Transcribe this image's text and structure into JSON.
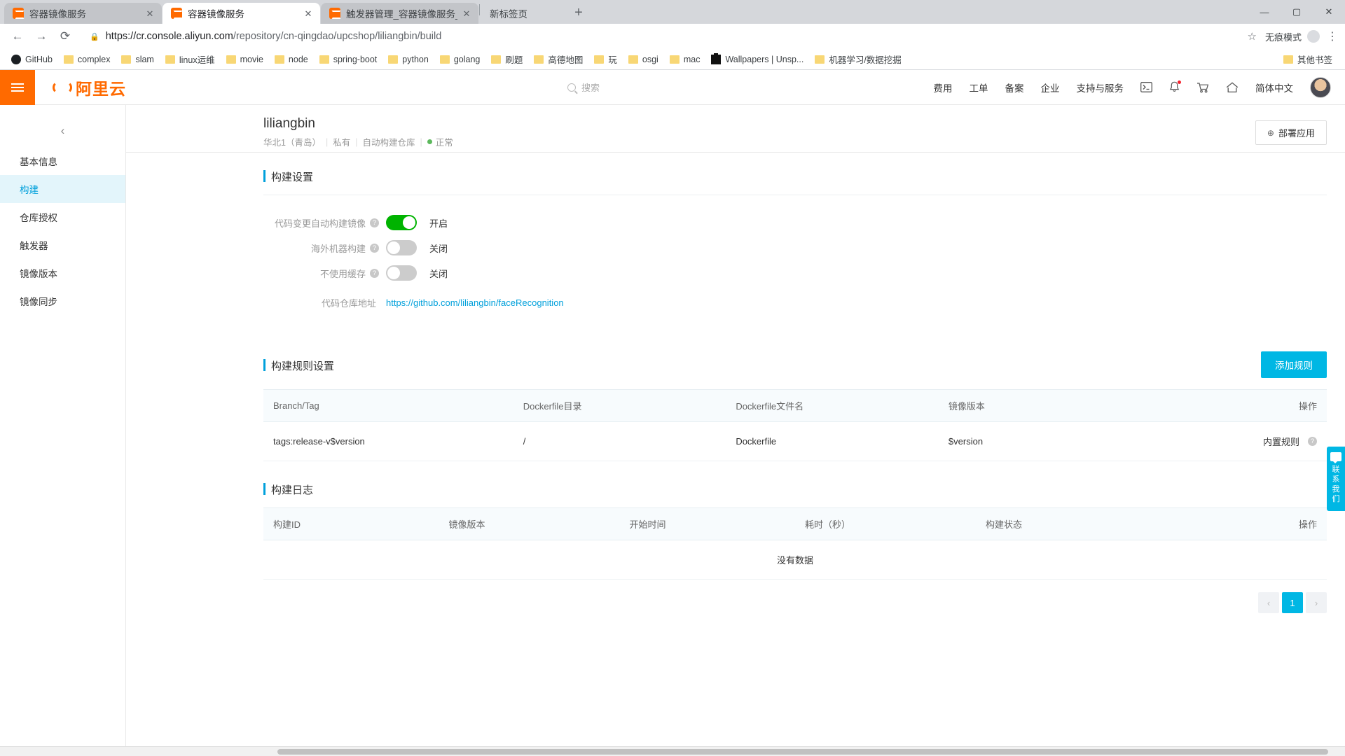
{
  "browser": {
    "tabs": [
      {
        "title": "容器镜像服务",
        "active": false,
        "close": "✕"
      },
      {
        "title": "容器镜像服务",
        "active": true,
        "close": "✕"
      },
      {
        "title": "触发器管理_容器镜像服务_用户…",
        "active": false,
        "close": "✕"
      }
    ],
    "plain_tab": "新标签页",
    "new_tab_icon": "+",
    "window_controls": {
      "minimize": "—",
      "maximize": "▢",
      "close": "✕"
    },
    "nav": {
      "back": "←",
      "forward": "→",
      "reload": "⟳"
    },
    "omnibox": {
      "lock_icon": "🔒",
      "host": "https://cr.console.aliyun.com",
      "path": "/repository/cn-qingdao/upcshop/liliangbin/build",
      "star_icon": "☆"
    },
    "incognito_label": "无痕模式",
    "menu_icon": "⋮",
    "bookmarks": [
      {
        "label": "GitHub",
        "icon": "github-icon"
      },
      {
        "label": "complex",
        "icon": "folder-icon"
      },
      {
        "label": "slam",
        "icon": "folder-icon"
      },
      {
        "label": "linux运维",
        "icon": "folder-icon"
      },
      {
        "label": "movie",
        "icon": "folder-icon"
      },
      {
        "label": "node",
        "icon": "folder-icon"
      },
      {
        "label": "spring-boot",
        "icon": "folder-icon"
      },
      {
        "label": "python",
        "icon": "folder-icon"
      },
      {
        "label": "golang",
        "icon": "folder-icon"
      },
      {
        "label": "刷题",
        "icon": "folder-icon"
      },
      {
        "label": "高德地图",
        "icon": "folder-icon"
      },
      {
        "label": "玩",
        "icon": "folder-icon"
      },
      {
        "label": "osgi",
        "icon": "folder-icon"
      },
      {
        "label": "mac",
        "icon": "folder-icon"
      },
      {
        "label": "Wallpapers | Unsp...",
        "icon": "unsplash-icon"
      },
      {
        "label": "机器学习/数据挖掘",
        "icon": "folder-icon"
      }
    ],
    "other_bookmarks": "其他书签"
  },
  "header": {
    "logo_text": "阿里云",
    "search_placeholder": "搜索",
    "nav_items": [
      "费用",
      "工单",
      "备案",
      "企业",
      "支持与服务"
    ],
    "icons": [
      {
        "name": "terminal-icon",
        "glyph": "▣"
      },
      {
        "name": "bell-icon",
        "glyph": "🔔"
      },
      {
        "name": "cart-icon",
        "glyph": "🛒"
      },
      {
        "name": "home-icon",
        "glyph": "⌂"
      }
    ],
    "language": "简体中文"
  },
  "sidebar": {
    "collapse_icon": "‹",
    "items": [
      {
        "label": "基本信息",
        "active": false
      },
      {
        "label": "构建",
        "active": true
      },
      {
        "label": "仓库授权",
        "active": false
      },
      {
        "label": "触发器",
        "active": false
      },
      {
        "label": "镜像版本",
        "active": false
      },
      {
        "label": "镜像同步",
        "active": false
      }
    ]
  },
  "page": {
    "title": "liliangbin",
    "meta": [
      "华北1（青岛）",
      "私有",
      "自动构建仓库"
    ],
    "status": "正常",
    "deploy_button": "部署应用",
    "deploy_icon": "⊕"
  },
  "build_settings": {
    "section_title": "构建设置",
    "rows": [
      {
        "label": "代码变更自动构建镜像",
        "state": "on",
        "state_text": "开启",
        "help": "?"
      },
      {
        "label": "海外机器构建",
        "state": "off",
        "state_text": "关闭",
        "help": "?"
      },
      {
        "label": "不使用缓存",
        "state": "off",
        "state_text": "关闭",
        "help": "?"
      }
    ],
    "repo_label": "代码仓库地址",
    "repo_url": "https://github.com/liliangbin/faceRecognition"
  },
  "build_rules": {
    "section_title": "构建规则设置",
    "add_button": "添加规则",
    "columns": [
      "Branch/Tag",
      "Dockerfile目录",
      "Dockerfile文件名",
      "镜像版本",
      "操作"
    ],
    "rows": [
      {
        "branch_tag": "tags:release-v$version",
        "dockerfile_dir": "/",
        "dockerfile_name": "Dockerfile",
        "image_version": "$version",
        "action": "内置规则",
        "action_help": "?"
      }
    ]
  },
  "build_logs": {
    "section_title": "构建日志",
    "columns": [
      "构建ID",
      "镜像版本",
      "开始时间",
      "耗时（秒）",
      "构建状态",
      "操作"
    ],
    "empty_text": "没有数据",
    "pagination": {
      "prev": "‹",
      "current": "1",
      "next": "›"
    }
  },
  "contact_widget": {
    "text": "联系我们"
  },
  "colors": {
    "brand_orange": "#ff6a00",
    "accent_cyan": "#00b7e4",
    "link_blue": "#00a0db",
    "switch_on_green": "#00b300",
    "status_green": "#5cb85c"
  }
}
